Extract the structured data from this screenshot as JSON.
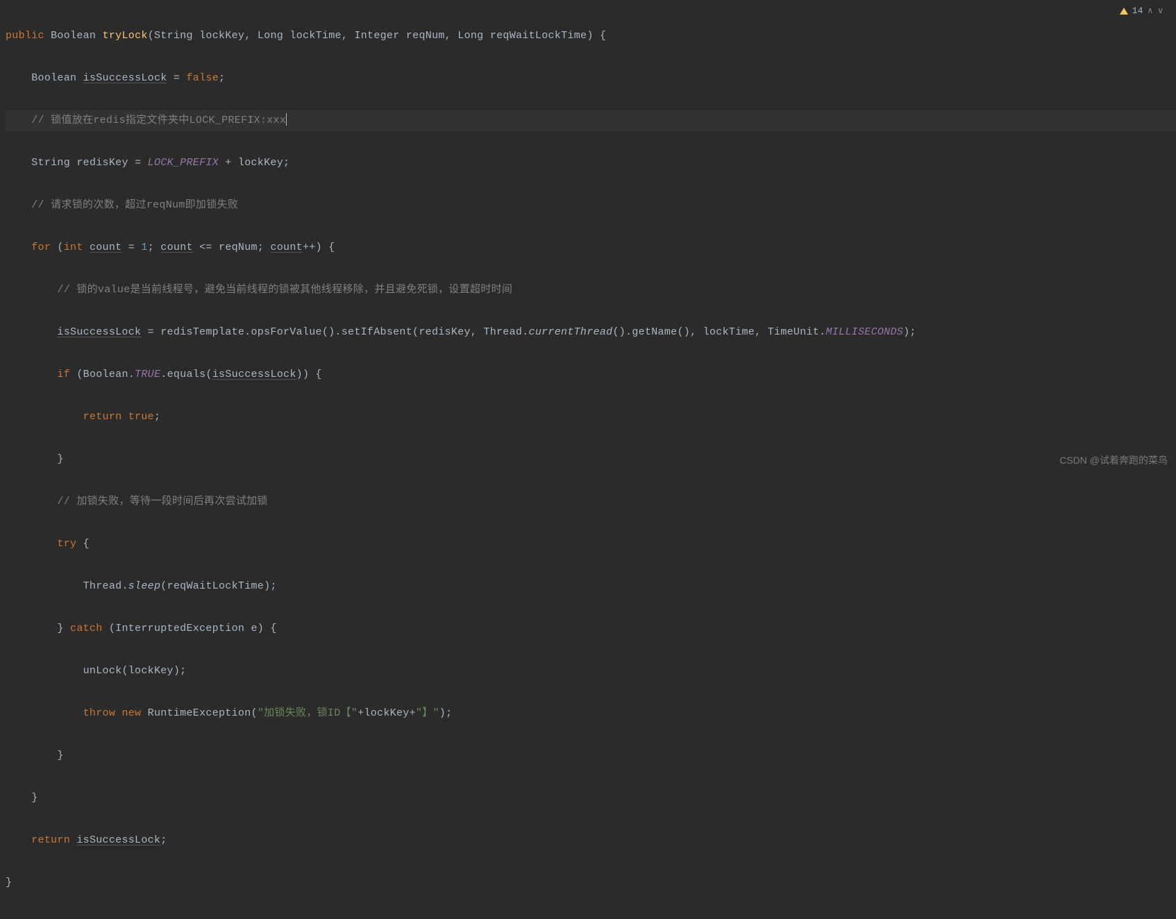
{
  "warning": {
    "count": "14"
  },
  "code": {
    "l1": {
      "kw1": "public",
      "type1": "Boolean",
      "method": "tryLock",
      "p1t": "String",
      "p1n": "lockKey",
      "p2t": "Long",
      "p2n": "lockTime",
      "p3t": "Integer",
      "p3n": "reqNum",
      "p4t": "Long",
      "p4n": "reqWaitLockTime"
    },
    "l2": {
      "type": "Boolean",
      "var": "isSuccessLock",
      "val": "false"
    },
    "l3": {
      "comment": "// 锁值放在redis指定文件夹中LOCK_PREFIX:xxx"
    },
    "l4": {
      "type": "String",
      "var": "redisKey",
      "const": "LOCK_PREFIX",
      "var2": "lockKey"
    },
    "l5": {
      "comment": "// 请求锁的次数，超过reqNum即加锁失败"
    },
    "l6": {
      "kw": "for",
      "type": "int",
      "var": "count",
      "init": "1",
      "cond": "reqNum",
      "inc": "count"
    },
    "l7": {
      "comment": "// 锁的value是当前线程号，避免当前线程的锁被其他线程移除，并且避免死锁，设置超时时间"
    },
    "l8": {
      "var": "isSuccessLock",
      "obj": "redisTemplate",
      "m1": "opsForValue",
      "m2": "setIfAbsent",
      "a1": "redisKey",
      "a2c": "Thread",
      "a2m": "currentThread",
      "a2m2": "getName",
      "a3": "lockTime",
      "a4c": "TimeUnit",
      "a4f": "MILLISECONDS"
    },
    "l9": {
      "kw": "if",
      "cls": "Boolean",
      "const": "TRUE",
      "m": "equals",
      "arg": "isSuccessLock"
    },
    "l10": {
      "kw": "return",
      "val": "true"
    },
    "l11": {
      "comment": "// 加锁失败，等待一段时间后再次尝试加锁"
    },
    "l12": {
      "kw": "try"
    },
    "l13": {
      "cls": "Thread",
      "m": "sleep",
      "arg": "reqWaitLockTime"
    },
    "l14": {
      "kw": "catch",
      "ex": "InterruptedException",
      "var": "e"
    },
    "l15": {
      "m": "unLock",
      "arg": "lockKey"
    },
    "l16": {
      "kw1": "throw",
      "kw2": "new",
      "cls": "RuntimeException",
      "s1": "\"加锁失败，锁ID【\"",
      "var": "lockKey",
      "s2": "\"】\""
    },
    "l17": {
      "kw": "return",
      "var": "isSuccessLock"
    }
  },
  "watermark": "CSDN @试着奔跑的菜鸟"
}
